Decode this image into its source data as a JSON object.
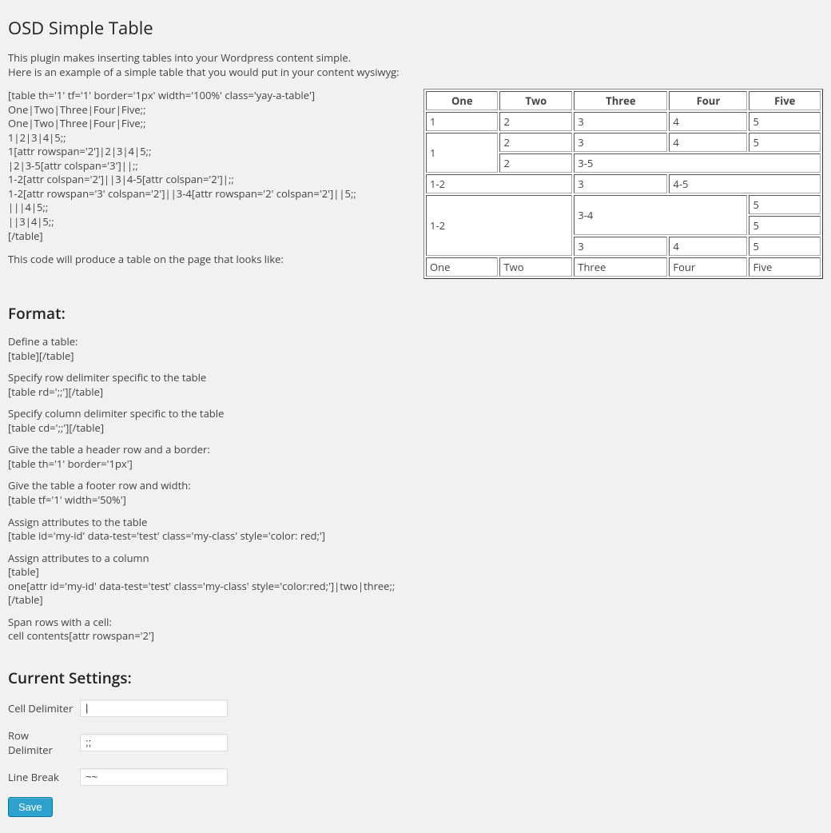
{
  "title": "OSD Simple Table",
  "intro": {
    "line1": "This plugin makes inserting tables into your Wordpress content simple.",
    "line2": "Here is an example of a simple table that you would put in your content wysiwyg:"
  },
  "example_code": "[table th='1' tf='1' border='1px' width='100%' class='yay-a-table']\nOne|Two|Three|Four|Five;;\nOne|Two|Three|Four|Five;;\n1|2|3|4|5;;\n1[attr rowspan='2']|2|3|4|5;;\n|2|3-5[attr colspan='3']||;;\n1-2[attr colspan='2']||3|4-5[attr colspan='2']|;;\n1-2[attr rowspan='3' colspan='2']||3-4[attr rowspan='2' colspan='2']||5;;\n|||4|5;;\n||3|4|5;;\n[/table]",
  "example_result_intro": "This code will produce a table on the page that looks like:",
  "table": {
    "headers": [
      "One",
      "Two",
      "Three",
      "Four",
      "Five"
    ],
    "footers": [
      "One",
      "Two",
      "Three",
      "Four",
      "Five"
    ],
    "rows": [
      [
        {
          "t": "1"
        },
        {
          "t": "2"
        },
        {
          "t": "3"
        },
        {
          "t": "4"
        },
        {
          "t": "5"
        }
      ],
      [
        {
          "t": "1",
          "rowspan": 2
        },
        {
          "t": "2"
        },
        {
          "t": "3"
        },
        {
          "t": "4"
        },
        {
          "t": "5"
        }
      ],
      [
        {
          "t": "2"
        },
        {
          "t": "3-5",
          "colspan": 3
        }
      ],
      [
        {
          "t": "1-2",
          "colspan": 2
        },
        {
          "t": "3"
        },
        {
          "t": "4-5",
          "colspan": 2
        }
      ],
      [
        {
          "t": "1-2",
          "rowspan": 3,
          "colspan": 2
        },
        {
          "t": "3-4",
          "rowspan": 2,
          "colspan": 2
        },
        {
          "t": "5"
        }
      ],
      [
        {
          "t": "5"
        }
      ],
      [
        {
          "t": "3"
        },
        {
          "t": "4"
        },
        {
          "t": "5"
        }
      ]
    ]
  },
  "format_heading": "Format:",
  "format_items": [
    {
      "desc": "Define a table:",
      "code": "[table][/table]"
    },
    {
      "desc": "Specify row delimiter specific to the table",
      "code": "[table rd=';;'][/table]"
    },
    {
      "desc": "Specify column delimiter specific to the table",
      "code": "[table cd=';;'][/table]"
    },
    {
      "desc": "Give the table a header row and a border:",
      "code": "[table th='1' border='1px']"
    },
    {
      "desc": "Give the table a footer row and width:",
      "code": "[table tf='1' width='50%']"
    },
    {
      "desc": "Assign attributes to the table",
      "code": "[table id='my-id' data-test='test' class='my-class' style='color: red;']"
    },
    {
      "desc": "Assign attributes to a column",
      "code": "[table]\none[attr id='my-id' data-test='test' class='my-class' style='color:red;']|two|three;;\n[/table]"
    },
    {
      "desc": "Span rows with a cell:",
      "code": "cell contents[attr rowspan='2']"
    }
  ],
  "settings_heading": "Current Settings:",
  "settings": {
    "cell_delimiter_label": "Cell Delimiter",
    "cell_delimiter_value": "|",
    "row_delimiter_label": "Row Delimiter",
    "row_delimiter_value": ";;",
    "line_break_label": "Line Break",
    "line_break_value": "~~",
    "save_label": "Save"
  }
}
